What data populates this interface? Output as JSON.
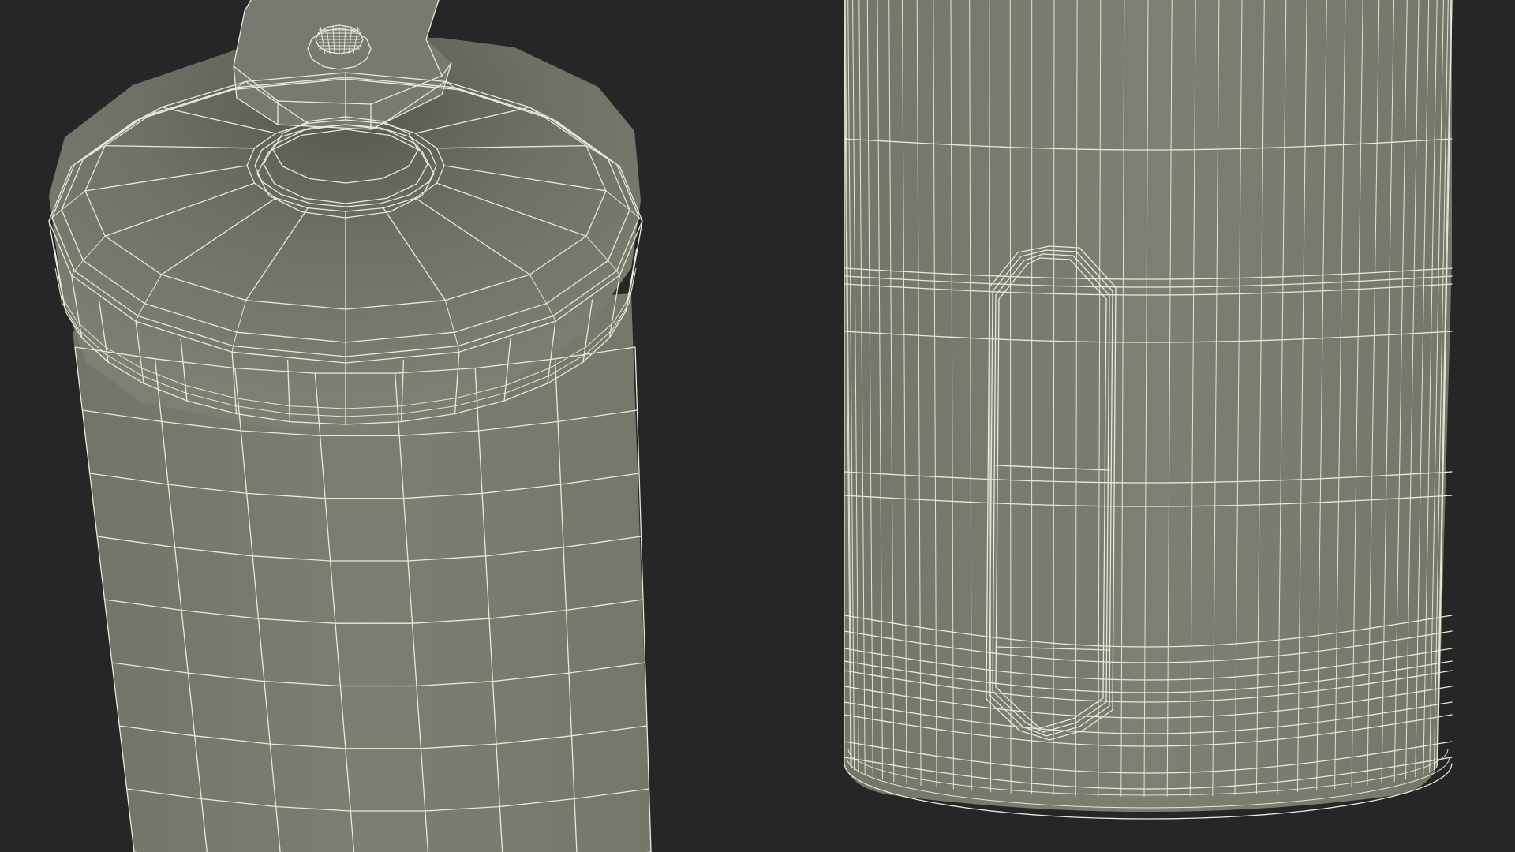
{
  "scene": {
    "background_color": "#262626",
    "surface_color": "#7b7c70",
    "wire_color": "#e9e9d9"
  },
  "left_object": {
    "name": "bottle-top-wireframe",
    "view": "top-perspective"
  },
  "right_object": {
    "name": "bottle-bottom-wireframe",
    "view": "side"
  }
}
